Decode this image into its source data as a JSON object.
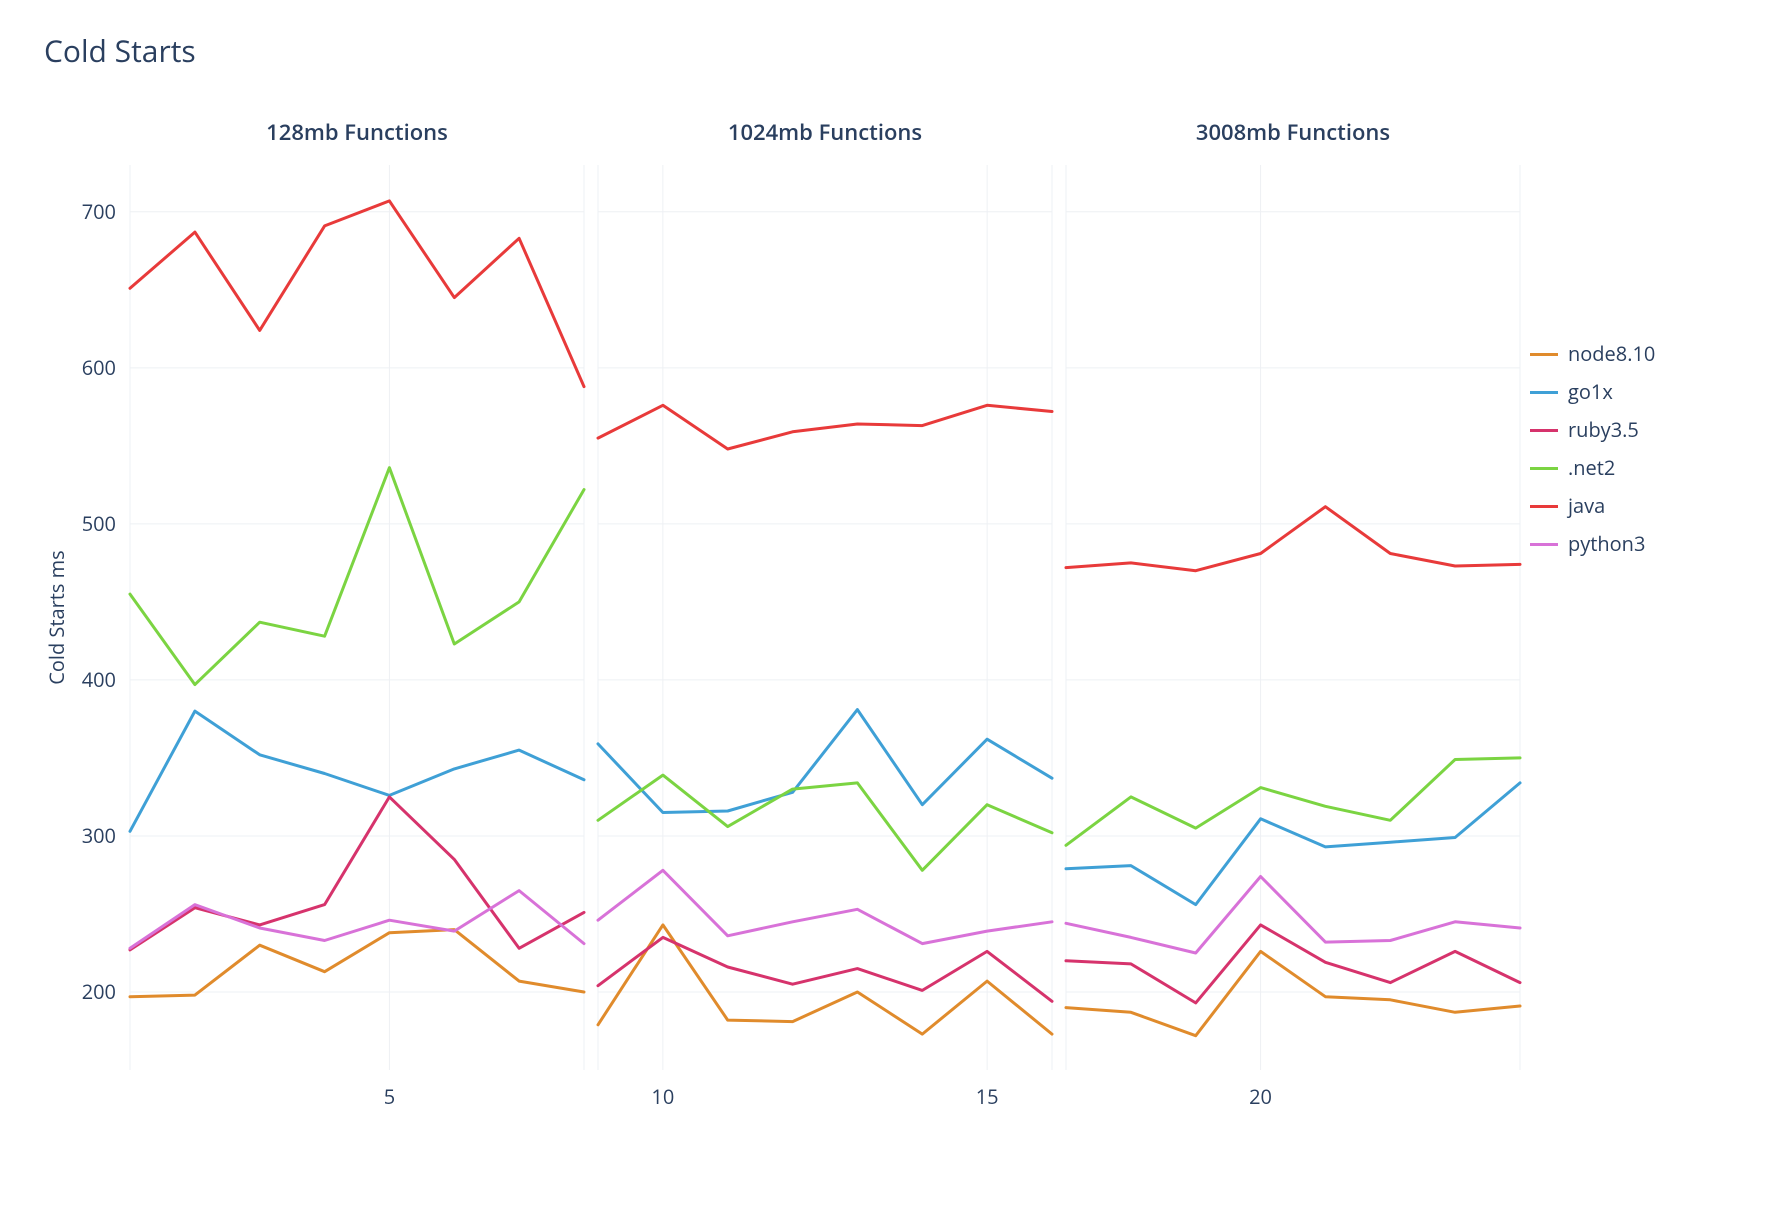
{
  "title": "Cold Starts",
  "ylabel": "Cold Starts ms",
  "ylim": [
    150,
    730
  ],
  "yticks": [
    200,
    300,
    400,
    500,
    600,
    700
  ],
  "xticks": [
    5,
    10,
    15,
    20
  ],
  "panels": [
    {
      "label": "128mb Functions",
      "x": [
        1,
        2,
        3,
        4,
        5,
        6,
        7,
        8
      ]
    },
    {
      "label": "1024mb Functions",
      "x": [
        9,
        10,
        11,
        12,
        13,
        14,
        15,
        16
      ]
    },
    {
      "label": "3008mb Functions",
      "x": [
        17,
        18,
        19,
        20,
        21,
        22,
        23,
        24
      ]
    }
  ],
  "series": [
    {
      "name": "node8.10",
      "color": "#e08b2c"
    },
    {
      "name": "go1x",
      "color": "#3fa0d6"
    },
    {
      "name": "ruby3.5",
      "color": "#d6336c"
    },
    {
      "name": ".net2",
      "color": "#7bd442"
    },
    {
      "name": "java",
      "color": "#e83a3a"
    },
    {
      "name": "python3",
      "color": "#d872d8"
    }
  ],
  "chart_data": {
    "type": "line",
    "title": "Cold Starts",
    "ylabel": "Cold Starts ms",
    "ylim": [
      150,
      730
    ],
    "panels": [
      "128mb Functions",
      "1024mb Functions",
      "3008mb Functions"
    ],
    "x": [
      1,
      2,
      3,
      4,
      5,
      6,
      7,
      8,
      9,
      10,
      11,
      12,
      13,
      14,
      15,
      16,
      17,
      18,
      19,
      20,
      21,
      22,
      23,
      24
    ],
    "series": [
      {
        "name": "node8.10",
        "color": "#e08b2c",
        "values": {
          "128mb Functions": [
            197,
            198,
            230,
            213,
            238,
            240,
            207,
            200
          ],
          "1024mb Functions": [
            179,
            243,
            182,
            181,
            200,
            173,
            207,
            173
          ],
          "3008mb Functions": [
            190,
            187,
            172,
            226,
            197,
            195,
            187,
            191
          ]
        }
      },
      {
        "name": "go1x",
        "color": "#3fa0d6",
        "values": {
          "128mb Functions": [
            303,
            380,
            352,
            340,
            326,
            343,
            355,
            336
          ],
          "1024mb Functions": [
            359,
            315,
            316,
            328,
            381,
            320,
            362,
            337
          ],
          "3008mb Functions": [
            279,
            281,
            256,
            311,
            293,
            296,
            299,
            334
          ]
        }
      },
      {
        "name": "ruby3.5",
        "color": "#d6336c",
        "values": {
          "128mb Functions": [
            227,
            254,
            243,
            256,
            325,
            285,
            228,
            251
          ],
          "1024mb Functions": [
            204,
            235,
            216,
            205,
            215,
            201,
            226,
            194
          ],
          "3008mb Functions": [
            220,
            218,
            193,
            243,
            219,
            206,
            226,
            206
          ]
        }
      },
      {
        "name": ".net2",
        "color": "#7bd442",
        "values": {
          "128mb Functions": [
            455,
            397,
            437,
            428,
            536,
            423,
            450,
            522
          ],
          "1024mb Functions": [
            310,
            339,
            306,
            330,
            334,
            278,
            320,
            302
          ],
          "3008mb Functions": [
            294,
            325,
            305,
            331,
            319,
            310,
            349,
            350
          ]
        }
      },
      {
        "name": "java",
        "color": "#e83a3a",
        "values": {
          "128mb Functions": [
            651,
            687,
            624,
            691,
            707,
            645,
            683,
            588
          ],
          "1024mb Functions": [
            555,
            576,
            548,
            559,
            564,
            563,
            576,
            572
          ],
          "3008mb Functions": [
            472,
            475,
            470,
            481,
            511,
            481,
            473,
            474
          ]
        }
      },
      {
        "name": "python3",
        "color": "#d872d8",
        "values": {
          "128mb Functions": [
            228,
            256,
            241,
            233,
            246,
            239,
            265,
            231
          ],
          "1024mb Functions": [
            246,
            278,
            236,
            245,
            253,
            231,
            239,
            245
          ],
          "3008mb Functions": [
            244,
            235,
            225,
            274,
            232,
            233,
            245,
            241
          ]
        }
      }
    ]
  }
}
